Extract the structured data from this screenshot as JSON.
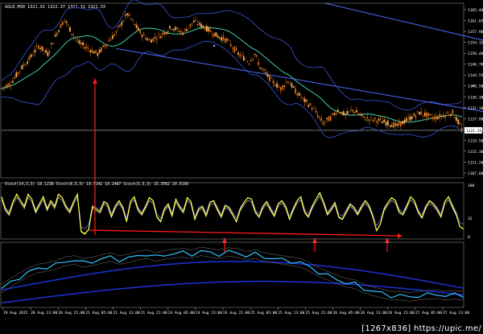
{
  "chart_data": [
    {
      "type": "candlestick",
      "title": "GOLD,M30  1321.91 1322.37 1321.31 1321.33",
      "ylim": [
        1103.5,
        1169
      ],
      "y_ticks": [
        "1165.40",
        "1161.65",
        "1157.90",
        "1154.15",
        "1150.40",
        "1146.70",
        "1144.55",
        "1140.50",
        "1136.30",
        "1132.10",
        "1127.90",
        "1123.75",
        "1119.50",
        "1115.30",
        "1111.20",
        "1107.00"
      ],
      "current_price_label": "1121.33",
      "x_ticks": [
        "19 Aug 2015",
        "20 Aug 13:00",
        "20 Aug 21:00",
        "21 Aug 05:00",
        "21 Aug 13:00",
        "21 Aug 21:00",
        "24 Aug 05:00",
        "24 Aug 13:00",
        "24 Aug 21:00",
        "25 Aug 05:00",
        "25 Aug 13:00",
        "25 Aug 21:00",
        "26 Aug 05:00",
        "26 Aug 13:00",
        "26 Aug 21:00",
        "27 Aug 05:00",
        "27 Aug 13:00"
      ],
      "price_path": [
        [
          0,
          1137
        ],
        [
          5,
          1139
        ],
        [
          10,
          1144
        ],
        [
          16,
          1149
        ],
        [
          20,
          1153
        ],
        [
          25,
          1150
        ],
        [
          30,
          1158
        ],
        [
          34,
          1163
        ],
        [
          38,
          1158
        ],
        [
          42,
          1154
        ],
        [
          47,
          1152
        ],
        [
          52,
          1150
        ],
        [
          57,
          1154
        ],
        [
          62,
          1158
        ],
        [
          68,
          1165
        ],
        [
          71,
          1162
        ],
        [
          75,
          1158
        ],
        [
          80,
          1155
        ],
        [
          86,
          1157
        ],
        [
          92,
          1160
        ],
        [
          98,
          1158
        ],
        [
          104,
          1162
        ],
        [
          110,
          1160
        ],
        [
          116,
          1157
        ],
        [
          122,
          1155
        ],
        [
          128,
          1150
        ],
        [
          134,
          1147
        ],
        [
          137,
          1150
        ],
        [
          140,
          1145
        ],
        [
          146,
          1140
        ],
        [
          151,
          1137
        ],
        [
          155,
          1140
        ],
        [
          159,
          1136
        ],
        [
          163,
          1133
        ],
        [
          168,
          1130
        ],
        [
          171,
          1127
        ],
        [
          174,
          1124
        ],
        [
          178,
          1126
        ],
        [
          182,
          1129
        ],
        [
          186,
          1127
        ],
        [
          190,
          1129
        ],
        [
          196,
          1126
        ],
        [
          204,
          1125
        ],
        [
          214,
          1123
        ],
        [
          226,
          1128
        ],
        [
          234,
          1126
        ],
        [
          244,
          1128
        ],
        [
          249,
          1122
        ]
      ],
      "channel_upper": [
        [
          175,
          1169
        ],
        [
          440,
          1126
        ]
      ],
      "channel_lower": [
        [
          62,
          1152
        ],
        [
          440,
          1107
        ]
      ],
      "channel_mid_marker": [
        [
          115,
          1153
        ],
        [
          255,
          1138
        ]
      ],
      "horizontal_line": 1121.33
    },
    {
      "type": "line",
      "title": "Stoch(14,3,3) 16.1238  Stoch(8,3,3) 19.7142 10.2487  Stoch(5,3,3) 15.3562 20.5199",
      "ylim": [
        0,
        100
      ],
      "y_ticks": [
        "100",
        "32",
        "0"
      ],
      "series": [
        {
          "values": [
            80,
            55,
            45,
            70,
            85,
            72,
            60,
            85,
            75,
            50,
            65,
            80,
            55,
            72,
            60,
            85,
            78,
            60,
            50,
            70,
            85,
            10,
            5,
            15,
            60,
            55,
            50,
            70,
            65,
            40,
            60,
            72,
            58,
            30,
            70,
            80,
            55,
            45,
            60,
            78,
            72,
            40,
            30,
            55,
            65,
            42,
            75,
            60,
            50,
            78,
            70,
            35,
            55,
            60,
            42,
            68,
            72,
            55,
            40,
            62,
            58,
            45,
            30,
            55,
            68,
            78,
            75,
            50,
            40,
            60,
            70,
            55,
            42,
            65,
            72,
            60,
            35,
            55,
            72,
            80,
            50,
            40,
            60,
            75,
            88,
            70,
            45,
            55,
            68,
            40,
            35,
            50,
            65,
            58,
            45,
            60,
            72,
            62,
            40,
            12,
            25,
            55,
            68,
            78,
            72,
            50,
            45,
            62,
            80,
            72,
            50,
            38,
            60,
            72,
            65,
            55,
            40,
            70,
            80,
            62,
            45,
            20,
            15
          ]
        }
      ]
    },
    {
      "type": "line",
      "title": "",
      "series": [
        {
          "values": [
            22,
            30,
            38,
            45,
            50,
            52,
            55,
            60,
            62,
            58,
            60,
            63,
            66,
            62,
            64,
            68,
            70,
            66,
            69,
            71,
            72,
            70,
            74,
            72,
            70,
            73,
            72,
            68,
            70,
            66,
            64,
            62,
            60,
            58,
            52,
            45,
            40,
            35,
            30,
            28,
            22,
            18,
            15,
            12,
            12,
            10,
            12,
            13,
            14,
            12,
            13,
            12
          ]
        }
      ]
    }
  ],
  "arrows_up": 3,
  "watermark": "[1267x836] https://upic.me/"
}
